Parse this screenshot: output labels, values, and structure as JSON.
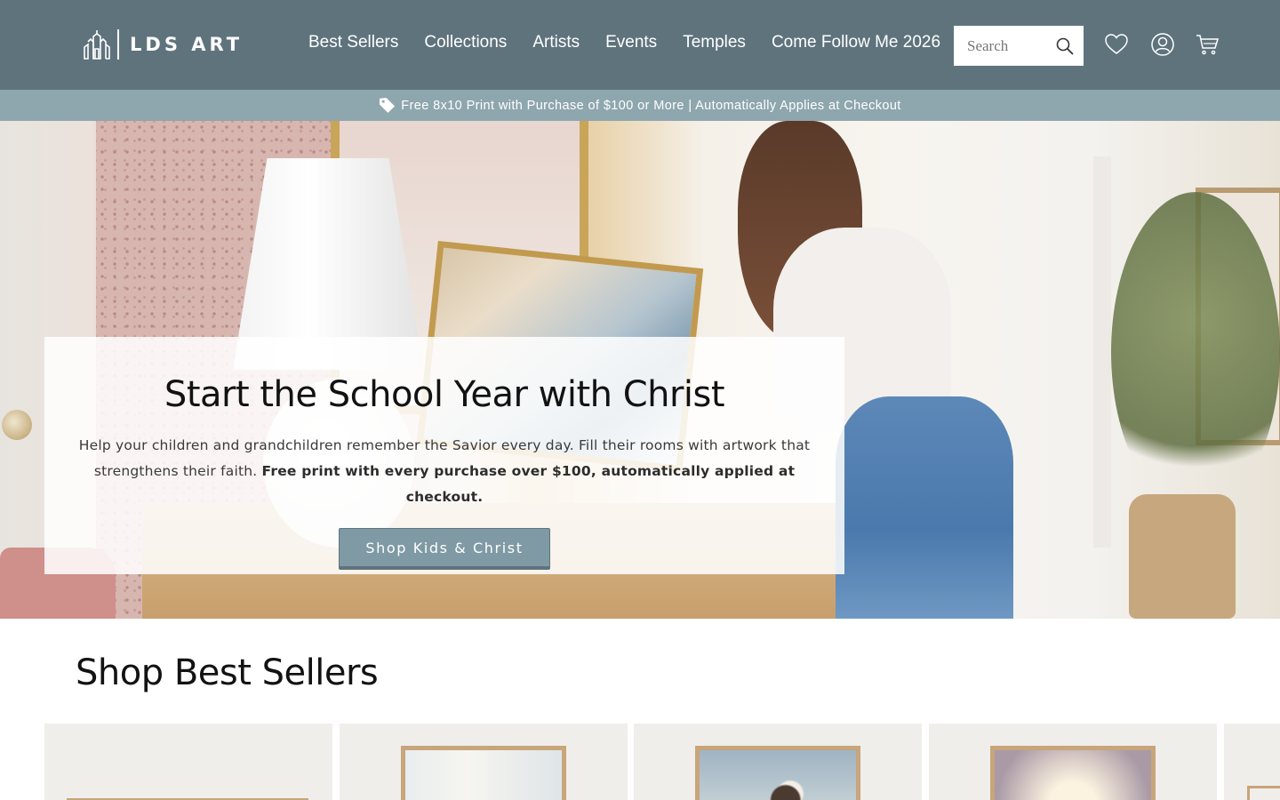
{
  "header": {
    "logo_text": "LDS ART",
    "nav": [
      "Best Sellers",
      "Collections",
      "Artists",
      "Events",
      "Temples",
      "Come Follow Me 2026"
    ],
    "search_placeholder": "Search",
    "icons": [
      "search-icon",
      "heart-icon",
      "account-icon",
      "cart-icon"
    ]
  },
  "announcement": {
    "text": "Free 8x10 Print with Purchase of $100 or More | Automatically Applies at Checkout",
    "icon": "tag-icon"
  },
  "hero": {
    "title": "Start the School Year with Christ",
    "body": "Help your children and grandchildren remember the Savior every day. Fill their rooms with artwork that strengthens their faith.",
    "body_bold": "Free print with every purchase over $100, automatically applied at checkout.",
    "button_label": "Shop Kids & Christ"
  },
  "best_sellers": {
    "title": "Shop Best Sellers",
    "products": [
      {
        "art": "empty-frame"
      },
      {
        "art": "light-abstract-painting"
      },
      {
        "art": "sky-figure-painting"
      },
      {
        "art": "glowing-portrait-painting"
      },
      {
        "art": "framed-painting"
      }
    ]
  },
  "colors": {
    "header_bg": "#5f737d",
    "announcement_bg": "#8ea6ae",
    "button_bg": "#7f9aa4",
    "card_bg": "#efeeeb"
  }
}
